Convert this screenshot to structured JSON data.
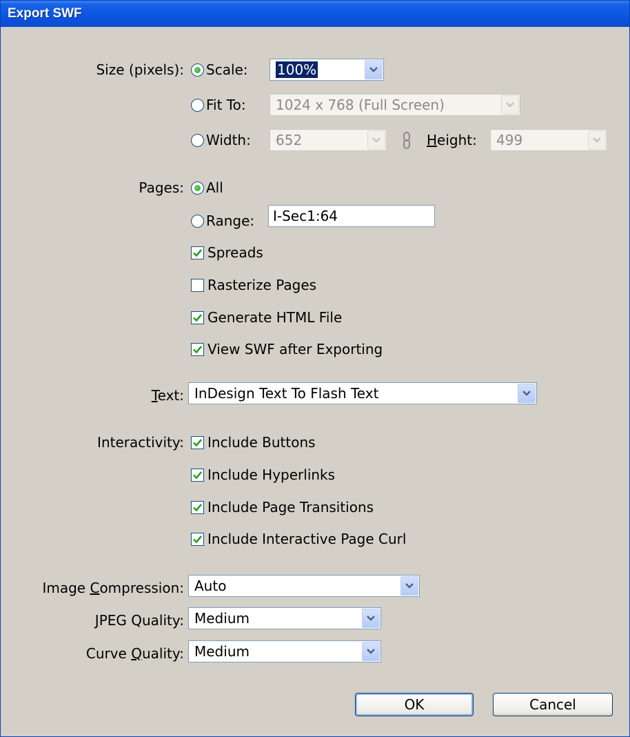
{
  "window": {
    "title": "Export SWF"
  },
  "size": {
    "label": "Size (pixels):",
    "scale_label": "Scale:",
    "scale_value": "100%",
    "fit_label": "Fit To:",
    "fit_value": "1024 x 768 (Full Screen)",
    "width_label": "Width:",
    "width_value": "652",
    "height_label": "Height:",
    "height_value": "499",
    "selected": "Scale"
  },
  "pages": {
    "label": "Pages:",
    "all_label": "All",
    "range_label": "Range:",
    "range_value": "I-Sec1:64",
    "selected": "All",
    "options": [
      {
        "label": "Spreads",
        "checked": true
      },
      {
        "label": "Rasterize Pages",
        "checked": false
      },
      {
        "label": "Generate HTML File",
        "checked": true
      },
      {
        "label": "View SWF after Exporting",
        "checked": true
      }
    ]
  },
  "text": {
    "label": "Text:",
    "value": "InDesign Text To Flash Text"
  },
  "interactivity": {
    "label": "Interactivity:",
    "options": [
      {
        "label": "Include Buttons",
        "checked": true
      },
      {
        "label": "Include Hyperlinks",
        "checked": true
      },
      {
        "label": "Include Page Transitions",
        "checked": true
      },
      {
        "label": "Include Interactive Page Curl",
        "checked": true
      }
    ]
  },
  "image_compression": {
    "label": "Image Compression:",
    "value": "Auto"
  },
  "jpeg_quality": {
    "label": "JPEG Quality:",
    "value": "Medium"
  },
  "curve_quality": {
    "label": "Curve Quality:",
    "value": "Medium"
  },
  "buttons": {
    "ok": "OK",
    "cancel": "Cancel"
  }
}
